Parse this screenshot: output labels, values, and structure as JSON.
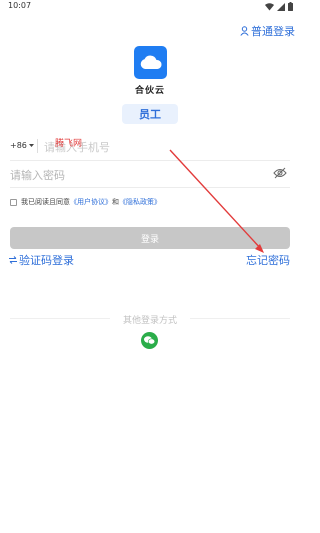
{
  "status_bar": {
    "time": "10:07"
  },
  "header": {
    "switch_link": "普通登录"
  },
  "brand": {
    "app_name": "合伙云",
    "role": "员工"
  },
  "form": {
    "country_code": "+86",
    "phone_placeholder": "请输入手机号",
    "password_placeholder": "请输入密码",
    "agree_prefix": "我已阅读且同意",
    "user_agreement": "《用户协议》",
    "agree_and": "和",
    "privacy_policy": "《隐私政策》",
    "login_button": "登录",
    "sms_login": "验证码登录",
    "forgot_password": "忘记密码"
  },
  "other_login": {
    "label": "其他登录方式"
  },
  "annotation": {
    "watermark": "腾飞网"
  },
  "colors": {
    "accent": "#2f6fd9",
    "logo": "#1f7df2",
    "wechat": "#2bad4a",
    "annotation": "#e23b3b"
  }
}
